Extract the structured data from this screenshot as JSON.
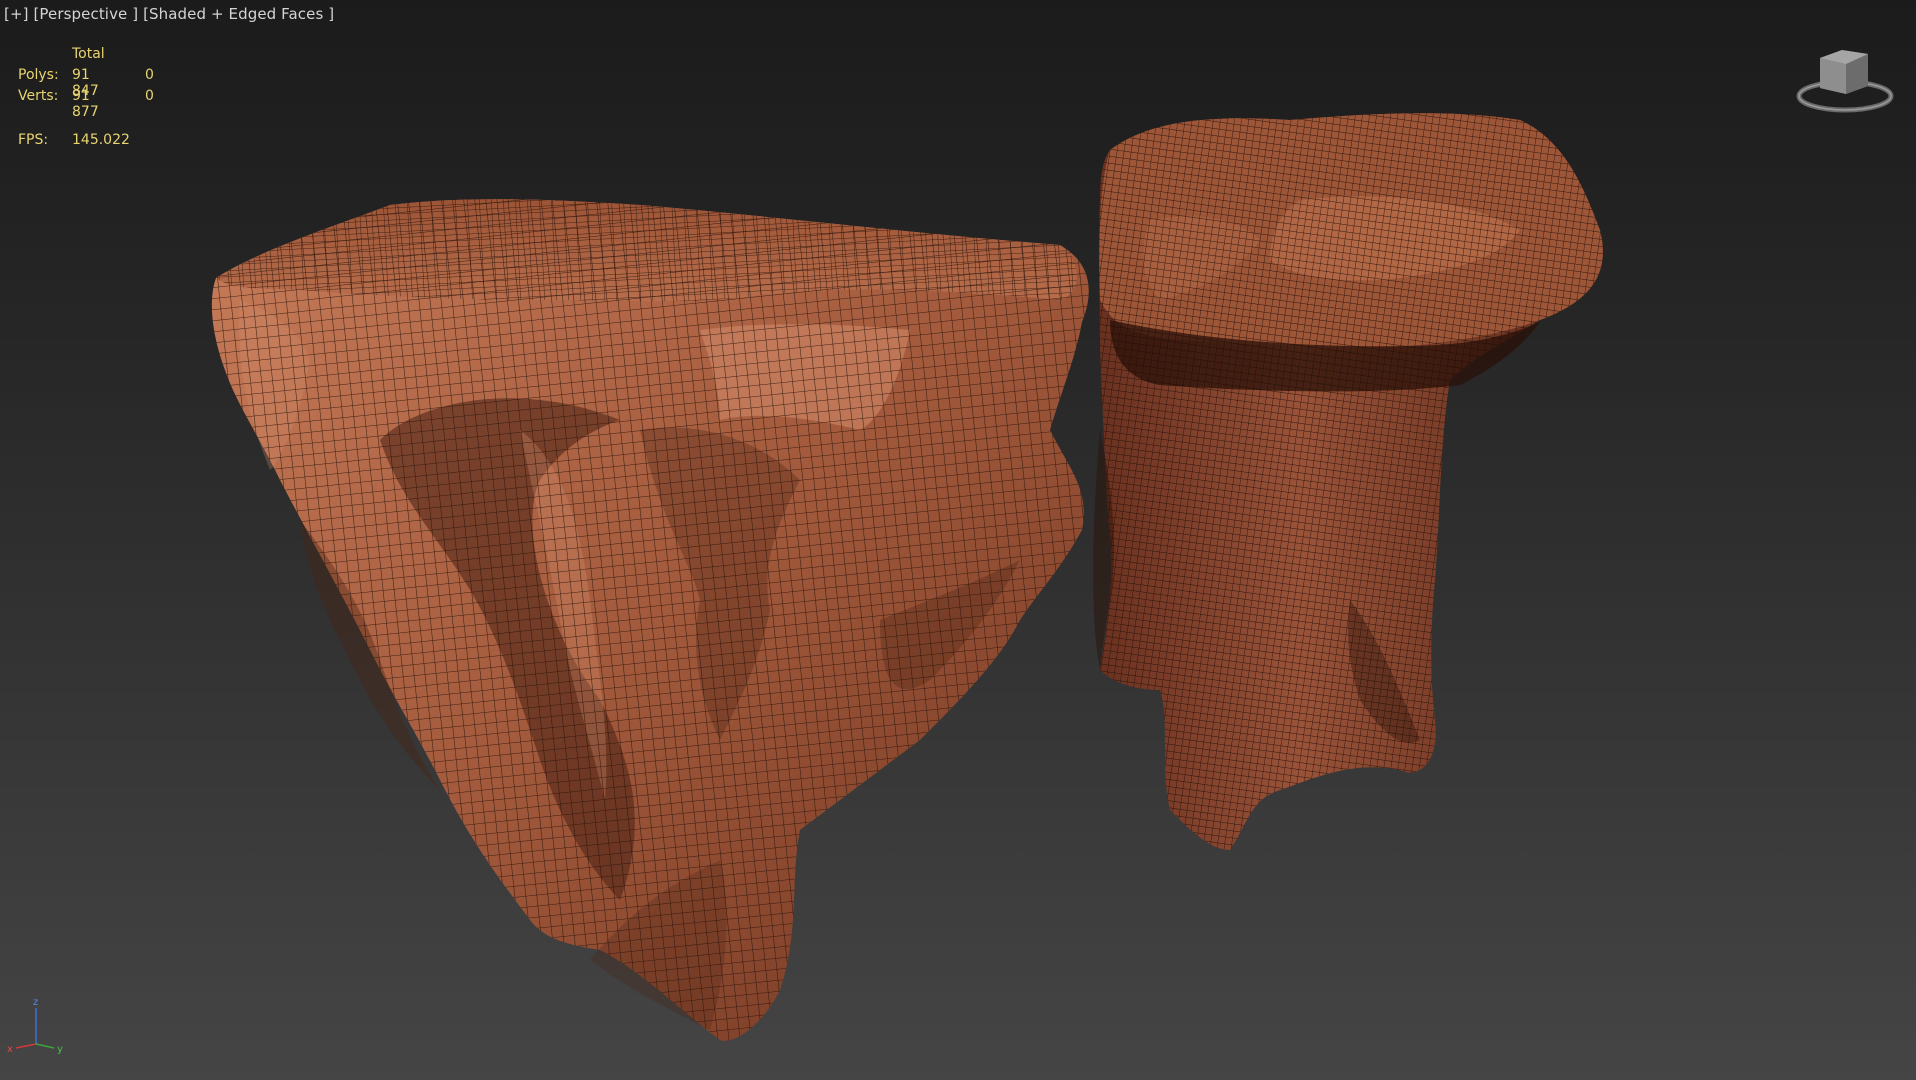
{
  "viewport": {
    "labels": {
      "menu": "[+]",
      "view": "[Perspective ]",
      "shading": "[Shaded + Edged Faces ]"
    },
    "stats": {
      "header": "Total",
      "rows": [
        {
          "label": "Polys:",
          "total": "91 847",
          "selected": "0"
        },
        {
          "label": "Verts:",
          "total": "91 877",
          "selected": "0"
        }
      ],
      "fps_label": "FPS:",
      "fps_value": "145.022"
    },
    "viewcube": {
      "icon": "viewcube-icon"
    },
    "axis": {
      "x": "x",
      "y": "y",
      "z": "z"
    }
  },
  "colors": {
    "stats_text": "#e8d470",
    "label_text": "#d4d4d4",
    "rock_base": "#a0553a",
    "rock_light": "#c47a58",
    "rock_shadow": "#4a2214",
    "wire": "#2a130a"
  },
  "scene": {
    "objects": [
      {
        "name": "rock-cliff-large"
      },
      {
        "name": "rock-pillar"
      }
    ]
  }
}
